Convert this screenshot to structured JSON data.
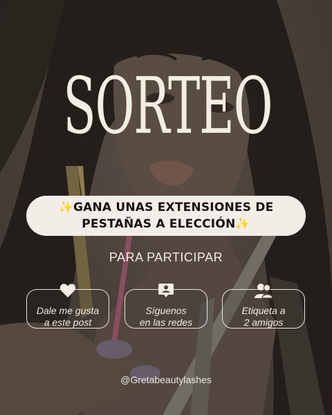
{
  "post": {
    "title": "SORTEO",
    "prize": {
      "line1": "✨GANA UNAS EXTENSIONES DE",
      "line2": "PESTAÑAS A ELECCIÓN✨"
    },
    "subtitle": "PARA PARTICIPAR",
    "steps": [
      {
        "icon": "heart-icon",
        "line1": "Dale me gusta",
        "line2": "a este post"
      },
      {
        "icon": "profile-speech-icon",
        "line1": "Síguenos",
        "line2": "en las redes"
      },
      {
        "icon": "two-people-icon",
        "line1": "Etiqueta a",
        "line2": "2 amigos"
      }
    ],
    "handle": "@Gretabeautylashes"
  },
  "colors": {
    "background": "#514740",
    "text": "#f3ede4",
    "pill_bg": "#f2ede6",
    "pill_text": "#161412",
    "nails": "#7a6f86"
  }
}
